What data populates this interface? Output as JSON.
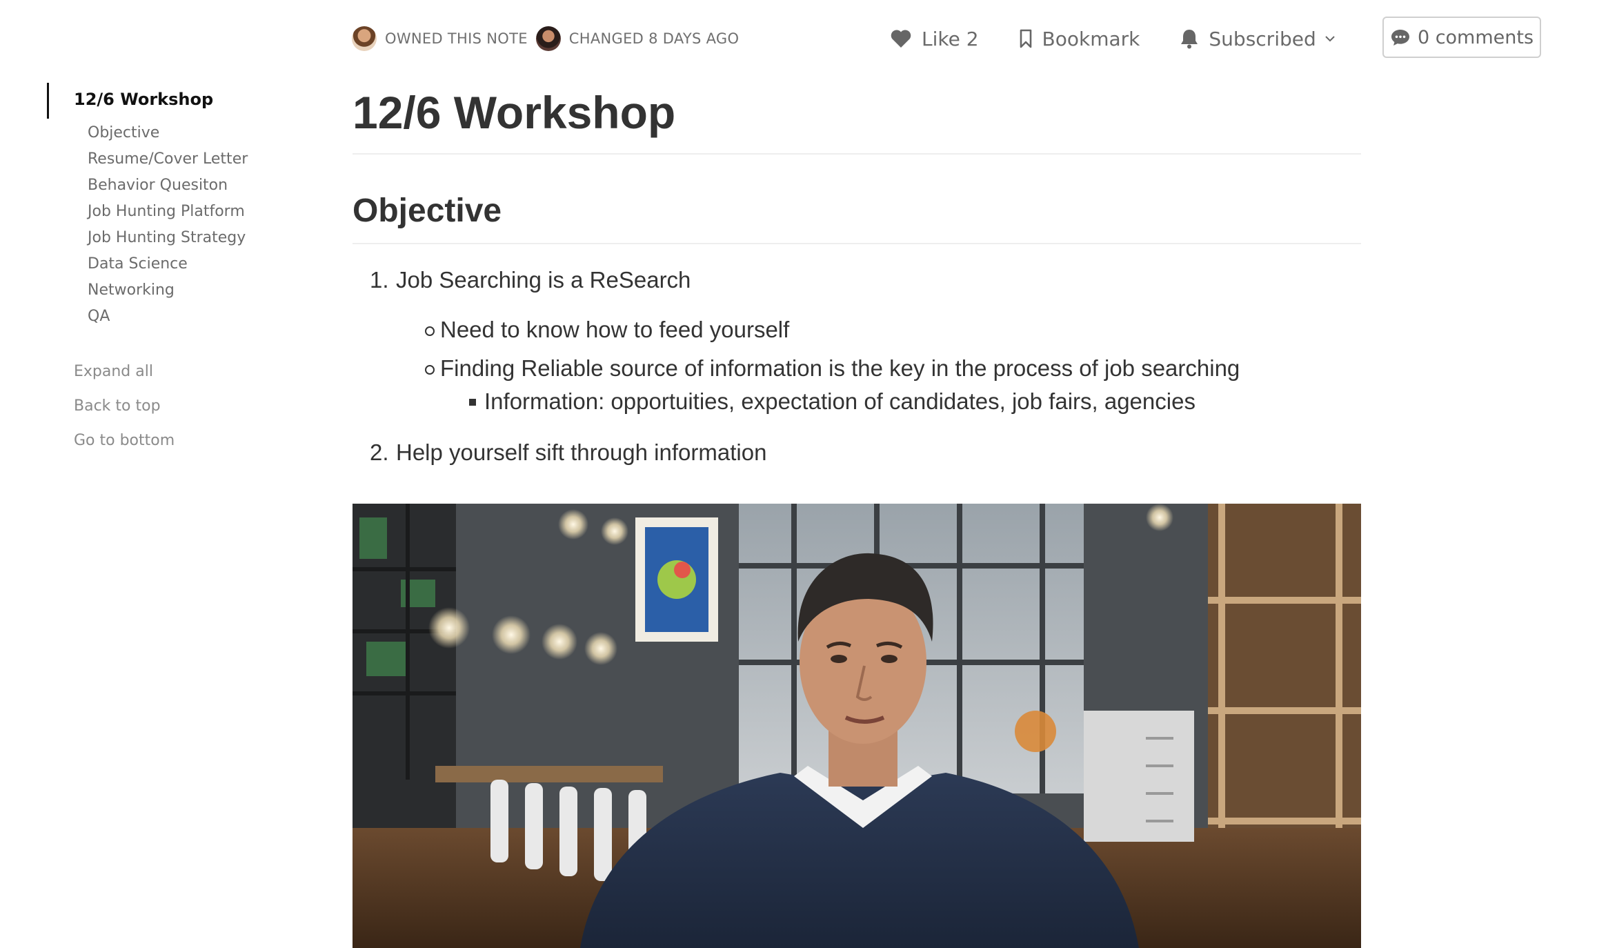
{
  "meta": {
    "owner_label": "OWNED THIS NOTE",
    "changed_label": "CHANGED 8 DAYS AGO"
  },
  "actions": {
    "like_label": "Like 2",
    "bookmark_label": "Bookmark",
    "subscribed_label": "Subscribed",
    "comments_label": "0 comments"
  },
  "toc": {
    "active": "12/6 Workshop",
    "items": [
      "Objective",
      "Resume/Cover Letter",
      "Behavior Quesiton",
      "Job Hunting Platform",
      "Job Hunting Strategy",
      "Data Science",
      "Networking",
      "QA"
    ],
    "expand_all": "Expand all",
    "back_to_top": "Back to top",
    "go_to_bottom": "Go to bottom"
  },
  "doc": {
    "title": "12/6 Workshop",
    "section_heading": "Objective",
    "list": [
      {
        "num": "1.",
        "text": "Job Searching is a ReSearch",
        "bullets": [
          "Need to know how to feed yourself",
          "Finding Reliable source of information is the key in the process of job searching"
        ],
        "sub_bullet": "Information: opportuities, expectation of candidates, job fairs, agencies"
      },
      {
        "num": "2.",
        "text": "Help yourself sift through information"
      }
    ]
  },
  "colors": {
    "text": "#333333",
    "muted": "#6b6b6b",
    "border": "#eeeeee"
  }
}
